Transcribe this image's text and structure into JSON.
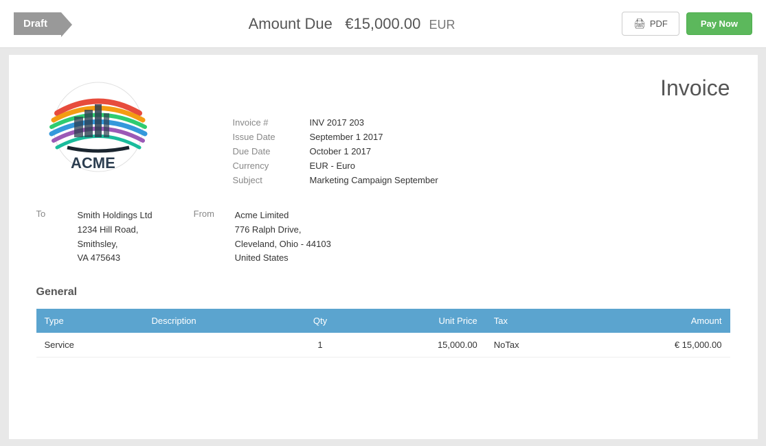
{
  "topbar": {
    "draft_label": "Draft",
    "amount_due_label": "Amount Due",
    "amount_value": "€15,000.00",
    "currency_code": "EUR",
    "pdf_button_label": "PDF",
    "pay_button_label": "Pay Now"
  },
  "invoice": {
    "title": "Invoice",
    "fields": {
      "invoice_number_label": "Invoice #",
      "invoice_number_value": "INV 2017 203",
      "issue_date_label": "Issue Date",
      "issue_date_value": "September 1 2017",
      "due_date_label": "Due Date",
      "due_date_value": "October 1 2017",
      "currency_label": "Currency",
      "currency_value": "EUR - Euro",
      "subject_label": "Subject",
      "subject_value": "Marketing Campaign September"
    },
    "to_label": "To",
    "to_name": "Smith Holdings Ltd",
    "to_address_line1": "1234 Hill Road,",
    "to_address_line2": "Smithsley,",
    "to_address_line3": "VA 475643",
    "from_label": "From",
    "from_name": "Acme Limited",
    "from_address_line1": "776 Ralph Drive,",
    "from_address_line2": "Cleveland, Ohio - 44103",
    "from_address_line3": "United States",
    "general_section_title": "General",
    "table_headers": {
      "type": "Type",
      "description": "Description",
      "qty": "Qty",
      "unit_price": "Unit Price",
      "tax": "Tax",
      "amount": "Amount"
    },
    "table_rows": [
      {
        "type": "Service",
        "description": "",
        "qty": "1",
        "unit_price": "15,000.00",
        "tax": "NoTax",
        "amount": "€ 15,000.00"
      }
    ]
  }
}
